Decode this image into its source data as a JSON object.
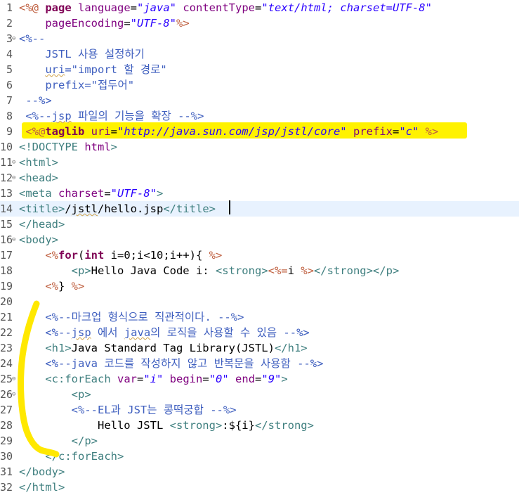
{
  "editor": {
    "language": "JSP",
    "current_line": 14,
    "highlighted_line": 9,
    "lines": [
      {
        "n": "1",
        "fold": false,
        "segs": [
          [
            "dl",
            "<%@ "
          ],
          [
            "kw",
            "page "
          ],
          [
            "atn",
            "language"
          ],
          [
            "tx",
            "="
          ],
          [
            "atv",
            "\"java\""
          ],
          [
            "tx",
            " "
          ],
          [
            "atn",
            "contentType"
          ],
          [
            "tx",
            "="
          ],
          [
            "atv",
            "\"text/html; charset=UTF-8\""
          ]
        ]
      },
      {
        "n": "2",
        "fold": false,
        "segs": [
          [
            "tx",
            "    "
          ],
          [
            "atn",
            "pageEncoding"
          ],
          [
            "tx",
            "="
          ],
          [
            "atv",
            "\"UTF-8\""
          ],
          [
            "dl",
            "%>"
          ]
        ]
      },
      {
        "n": "3",
        "fold": true,
        "segs": [
          [
            "cm",
            "<%--"
          ]
        ]
      },
      {
        "n": "4",
        "fold": false,
        "segs": [
          [
            "cm",
            "    JSTL 사용 설정하기"
          ]
        ]
      },
      {
        "n": "5",
        "fold": false,
        "segs": [
          [
            "cm",
            "    "
          ],
          [
            "cm sq",
            "uri"
          ],
          [
            "cm",
            "=\"import 할 경로\""
          ]
        ]
      },
      {
        "n": "6",
        "fold": false,
        "segs": [
          [
            "cm",
            "    prefix=\"접두어\""
          ]
        ]
      },
      {
        "n": "7",
        "fold": false,
        "segs": [
          [
            "cm",
            " --%>"
          ]
        ]
      },
      {
        "n": "8",
        "fold": false,
        "segs": [
          [
            "cm",
            " <%--"
          ],
          [
            "cm sq",
            "jsp"
          ],
          [
            "cm",
            " 파일의 기능을 확장 --%>"
          ]
        ]
      },
      {
        "n": "9",
        "fold": false,
        "segs": [
          [
            "dl",
            " <%@"
          ],
          [
            "kw",
            "taglib "
          ],
          [
            "atn",
            "uri"
          ],
          [
            "tx",
            "="
          ],
          [
            "atv",
            "\"http://java.sun.com/jsp/jstl/core\""
          ],
          [
            "tx",
            " "
          ],
          [
            "atn",
            "prefix"
          ],
          [
            "tx",
            "="
          ],
          [
            "atv",
            "\"c\""
          ],
          [
            "tx",
            " "
          ],
          [
            "dl",
            "%>"
          ]
        ]
      },
      {
        "n": "10",
        "fold": false,
        "segs": [
          [
            "tg",
            "<!DOCTYPE "
          ],
          [
            "atn",
            "html"
          ],
          [
            "tg",
            ">"
          ]
        ]
      },
      {
        "n": "11",
        "fold": true,
        "segs": [
          [
            "tg",
            "<html>"
          ]
        ]
      },
      {
        "n": "12",
        "fold": true,
        "segs": [
          [
            "tg",
            "<head>"
          ]
        ]
      },
      {
        "n": "13",
        "fold": false,
        "segs": [
          [
            "tg",
            "<meta "
          ],
          [
            "atn",
            "charset"
          ],
          [
            "tx",
            "="
          ],
          [
            "atv",
            "\"UTF-8\""
          ],
          [
            "tg",
            ">"
          ]
        ]
      },
      {
        "n": "14",
        "fold": false,
        "segs": [
          [
            "tg",
            "<title>"
          ],
          [
            "tx",
            "/"
          ],
          [
            "tx sq",
            "jstl"
          ],
          [
            "tx",
            "/hello.jsp"
          ],
          [
            "tg",
            "</title>"
          ]
        ]
      },
      {
        "n": "15",
        "fold": false,
        "segs": [
          [
            "tg",
            "</head>"
          ]
        ]
      },
      {
        "n": "16",
        "fold": true,
        "segs": [
          [
            "tg",
            "<body>"
          ]
        ]
      },
      {
        "n": "17",
        "fold": false,
        "segs": [
          [
            "tx",
            "    "
          ],
          [
            "dl",
            "<%"
          ],
          [
            "kw",
            "for"
          ],
          [
            "tx",
            "("
          ],
          [
            "kw",
            "int"
          ],
          [
            "tx",
            " i=0;i<10;i++){ "
          ],
          [
            "dl",
            "%>"
          ]
        ]
      },
      {
        "n": "18",
        "fold": false,
        "segs": [
          [
            "tx",
            "        "
          ],
          [
            "tg",
            "<p>"
          ],
          [
            "tx",
            "Hello Java Code i: "
          ],
          [
            "tg",
            "<strong>"
          ],
          [
            "dl",
            "<%="
          ],
          [
            "tx",
            "i "
          ],
          [
            "dl",
            "%>"
          ],
          [
            "tg",
            "</strong></p>"
          ]
        ]
      },
      {
        "n": "19",
        "fold": false,
        "segs": [
          [
            "tx",
            "    "
          ],
          [
            "dl",
            "<%"
          ],
          [
            "tx",
            "} "
          ],
          [
            "dl",
            "%>"
          ]
        ]
      },
      {
        "n": "20",
        "fold": false,
        "segs": []
      },
      {
        "n": "21",
        "fold": false,
        "segs": [
          [
            "cm",
            "    <%--마크업 형식으로 직관적이다. --%>"
          ]
        ]
      },
      {
        "n": "22",
        "fold": false,
        "segs": [
          [
            "cm",
            "    <%--"
          ],
          [
            "cm sq",
            "jsp"
          ],
          [
            "cm",
            " 에서 "
          ],
          [
            "cm sq",
            "java"
          ],
          [
            "cm",
            "의 로직을 사용할 수 있음 --%>"
          ]
        ]
      },
      {
        "n": "23",
        "fold": false,
        "segs": [
          [
            "tx",
            "    "
          ],
          [
            "tg",
            "<h1>"
          ],
          [
            "tx",
            "Java Standard Tag Library(JSTL)"
          ],
          [
            "tg",
            "</h1>"
          ]
        ]
      },
      {
        "n": "24",
        "fold": false,
        "segs": [
          [
            "cm",
            "    <%--java 코드를 작성하지 않고 반복문을 사용함 --%>"
          ]
        ]
      },
      {
        "n": "25",
        "fold": true,
        "segs": [
          [
            "tx",
            "    "
          ],
          [
            "tg",
            "<c:forEach "
          ],
          [
            "atn",
            "var"
          ],
          [
            "tx",
            "="
          ],
          [
            "atv",
            "\"i\""
          ],
          [
            "tx",
            " "
          ],
          [
            "atn",
            "begin"
          ],
          [
            "tx",
            "="
          ],
          [
            "atv",
            "\"0\""
          ],
          [
            "tx",
            " "
          ],
          [
            "atn",
            "end"
          ],
          [
            "tx",
            "="
          ],
          [
            "atv",
            "\"9\""
          ],
          [
            "tg",
            ">"
          ]
        ]
      },
      {
        "n": "26",
        "fold": true,
        "segs": [
          [
            "tx",
            "        "
          ],
          [
            "tg",
            "<p>"
          ]
        ]
      },
      {
        "n": "27",
        "fold": false,
        "segs": [
          [
            "cm",
            "        <%--EL과 JST는 콩떡궁합 --%>"
          ]
        ]
      },
      {
        "n": "28",
        "fold": false,
        "segs": [
          [
            "tx",
            "            Hello JSTL "
          ],
          [
            "tg",
            "<strong>"
          ],
          [
            "tx",
            ":${i}"
          ],
          [
            "tg",
            "</strong>"
          ]
        ]
      },
      {
        "n": "29",
        "fold": false,
        "segs": [
          [
            "tx",
            "        "
          ],
          [
            "tg",
            "</p>"
          ]
        ]
      },
      {
        "n": "30",
        "fold": false,
        "segs": [
          [
            "tx",
            "    "
          ],
          [
            "tg",
            "</c:forEach>"
          ]
        ]
      },
      {
        "n": "31",
        "fold": false,
        "segs": [
          [
            "tg",
            "</body>"
          ]
        ]
      },
      {
        "n": "32",
        "fold": false,
        "segs": [
          [
            "tg",
            "</html>"
          ]
        ]
      }
    ]
  },
  "annotations": {
    "highlight_color": "#fff200",
    "pen_color": "#ffe800"
  }
}
